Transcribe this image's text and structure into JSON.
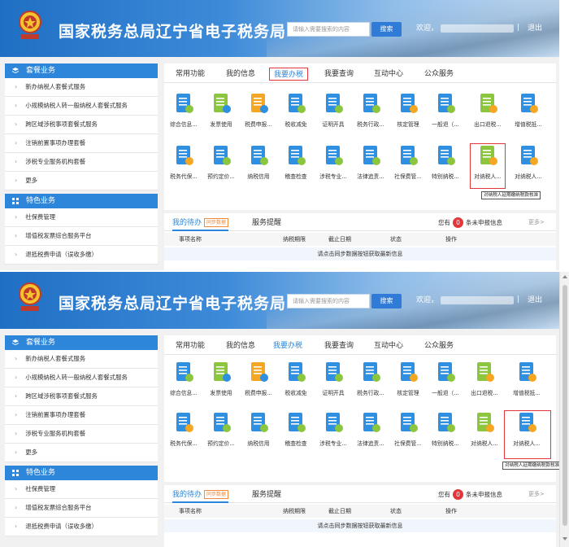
{
  "header": {
    "site_title": "国家税务总局辽宁省电子税务局",
    "search_placeholder": "请输入需要搜索的内容",
    "search_button": "搜索",
    "welcome": "欢迎，",
    "separator": "|",
    "logout": "退出"
  },
  "sidebar": {
    "section1_title": "套餐业务",
    "section1_items": [
      "新办纳税人套餐式服务",
      "小规模纳税人转一般纳税人套餐式服务",
      "跨区域涉税事项套餐式服务",
      "注销前置事项办理套餐",
      "涉税专业服务机构套餐",
      "更多"
    ],
    "section2_title": "特色业务",
    "section2_items": [
      "社保费管理",
      "增值税发票综合服务平台",
      "退抵税费申请（误收多缴）"
    ]
  },
  "tabs": [
    "常用功能",
    "我的信息",
    "我要办税",
    "我要查询",
    "互动中心",
    "公众服务"
  ],
  "functions": {
    "row1": [
      "综合信息...",
      "发票使用",
      "税费申报...",
      "税收减免",
      "证明开具",
      "税务行政...",
      "核定管理",
      "一般退（...",
      "出口退税...",
      "增值税抵..."
    ],
    "row2_shot1": [
      "税务代保...",
      "预约定价...",
      "纳税信用",
      "稽查检查",
      "涉税专业...",
      "法律追责...",
      "社保费管...",
      "特别纳税...",
      "对纳税人...",
      "对纳税人..."
    ],
    "row2_shot2": [
      "税务代保...",
      "预约定价...",
      "纳税信用",
      "稽查检查",
      "涉税专业...",
      "法律追责...",
      "社保费管...",
      "特别纳税...",
      "对纳税人...",
      "对纳税人..."
    ],
    "tooltip": "对纳税人延期缴纳税款核准"
  },
  "todo": {
    "tab1": "我的待办",
    "sync": "同步数据",
    "tab2": "服务提醒",
    "pending_prefix": "您有",
    "pending_count": "0",
    "pending_suffix": "条未申报信息",
    "more": "更多>",
    "columns": [
      "事项名称",
      "纳税期限",
      "截止日期",
      "状态",
      "操作"
    ],
    "empty_row": "请点击同步数据按钮获取最新信息"
  },
  "colors": {
    "primary": "#2d86d9",
    "highlight_box": "#e2363a",
    "icon_blue": "#2f8fe0",
    "icon_orange": "#f5a623",
    "icon_green": "#8cc63f"
  }
}
